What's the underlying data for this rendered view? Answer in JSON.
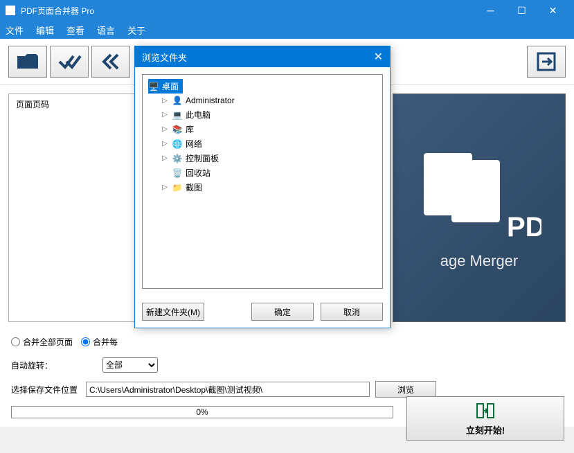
{
  "window": {
    "title": "PDF页面合并器 Pro"
  },
  "menubar": {
    "items": [
      "文件",
      "编辑",
      "查看",
      "语言",
      "关于"
    ]
  },
  "main": {
    "list_header": "页面页码",
    "logo_pdf": "PDF",
    "logo_text": "age Merger"
  },
  "options": {
    "merge_all_label": "合并全部页面",
    "merge_each_label": "合并每",
    "autorotate_label": "自动旋转：",
    "autorotate_value": "全部",
    "savepath_label": "选择保存文件位置",
    "savepath_value": "C:\\Users\\Administrator\\Desktop\\截图\\测试视频\\",
    "browse_btn": "浏览",
    "progress_text": "0%",
    "start_btn": "立刻开始!"
  },
  "dialog": {
    "title": "浏览文件夹",
    "tree": {
      "root": "桌面",
      "items": [
        "Administrator",
        "此电脑",
        "库",
        "网络",
        "控制面板",
        "回收站",
        "截图"
      ]
    },
    "new_folder_btn": "新建文件夹(M)",
    "ok_btn": "确定",
    "cancel_btn": "取消"
  }
}
